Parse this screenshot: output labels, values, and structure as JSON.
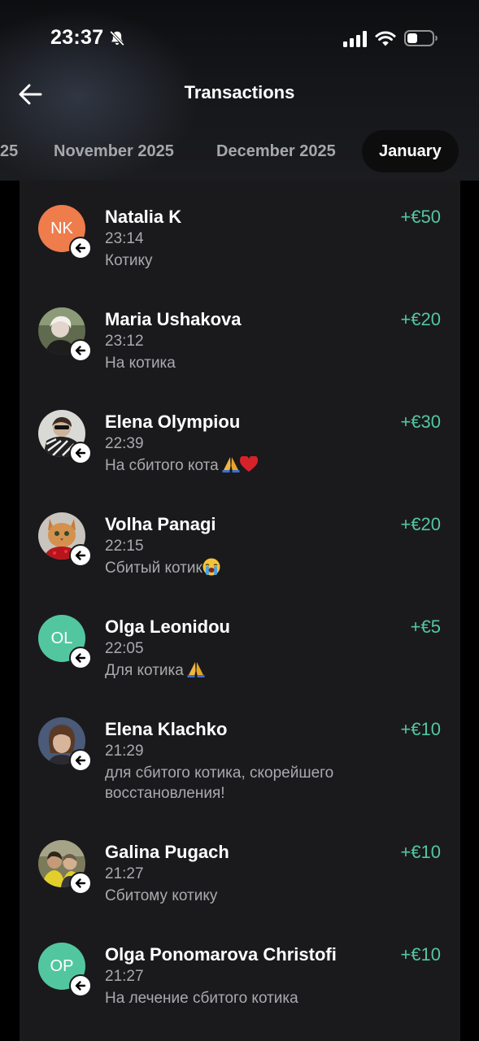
{
  "status_bar": {
    "time": "23:37",
    "icons": [
      "bell-slash-icon",
      "cellular-signal-icon",
      "wifi-icon",
      "battery-icon"
    ]
  },
  "header": {
    "back_icon": "arrow-left-icon",
    "title": "Transactions"
  },
  "month_tabs": [
    {
      "label": "25",
      "active": false
    },
    {
      "label": "November 2025",
      "active": false
    },
    {
      "label": "December 2025",
      "active": false
    },
    {
      "label": "January",
      "active": true
    }
  ],
  "transactions": [
    {
      "name": "Natalia K",
      "time": "23:14",
      "note": "Котику",
      "amount": "+€50",
      "avatar_type": "initials",
      "initials": "NK",
      "avatar_color": "#ef7c4b"
    },
    {
      "name": "Maria Ushakova",
      "time": "23:12",
      "note": "На котика",
      "amount": "+€20",
      "avatar_type": "photo"
    },
    {
      "name": "Elena Olympiou",
      "time": "22:39",
      "note": "На сбитого кота",
      "note_emoji": [
        "folded-hands-emoji",
        "red-heart-emoji"
      ],
      "amount": "+€30",
      "avatar_type": "photo"
    },
    {
      "name": "Volha Panagi",
      "time": "22:15",
      "note": "Сбитый котик",
      "note_emoji": [
        "loudly-crying-face-emoji"
      ],
      "amount": "+€20",
      "avatar_type": "photo"
    },
    {
      "name": "Olga Leonidou",
      "time": "22:05",
      "note": "Для котика",
      "note_emoji": [
        "folded-hands-emoji"
      ],
      "amount": "+€5",
      "avatar_type": "initials",
      "initials": "OL",
      "avatar_color": "#52c79f"
    },
    {
      "name": "Elena Klachko",
      "time": "21:29",
      "note": "для сбитого котика, скорейшего восстановления!",
      "amount": "+€10",
      "avatar_type": "photo"
    },
    {
      "name": "Galina Pugach",
      "time": "21:27",
      "note": "Сбитому котику",
      "amount": "+€10",
      "avatar_type": "photo"
    },
    {
      "name": "Olga Ponomarova Christofi",
      "time": "21:27",
      "note": "На лечение сбитого котика",
      "amount": "+€10",
      "avatar_type": "initials",
      "initials": "OP",
      "avatar_color": "#52c79f"
    }
  ],
  "colors": {
    "incoming_amount": "#52c7a0",
    "card_background": "#1a1a1c",
    "secondary_text": "#a9aaae"
  }
}
